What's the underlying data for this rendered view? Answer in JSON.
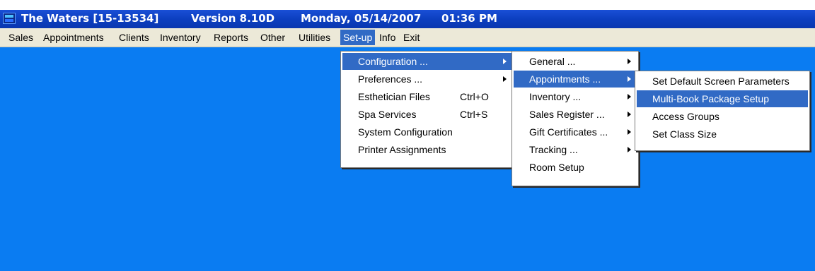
{
  "window": {
    "app_name": "The Waters [15-13534]",
    "version": "Version 8.10D",
    "date": "Monday, 05/14/2007",
    "time": "01:36 PM"
  },
  "menubar": {
    "items": [
      "Sales",
      "Appointments",
      "Clients",
      "Inventory",
      "Reports",
      "Other",
      "Utilities",
      "Set-up",
      "Info",
      "Exit"
    ],
    "active": "Set-up"
  },
  "setup_menu": {
    "items": [
      {
        "label": "Configuration ...",
        "shortcut": "",
        "submenu": true,
        "highlighted": true
      },
      {
        "label": "Preferences ...",
        "shortcut": "",
        "submenu": true,
        "highlighted": false
      },
      {
        "label": "Esthetician Files",
        "shortcut": "Ctrl+O",
        "submenu": false,
        "highlighted": false
      },
      {
        "label": "Spa Services",
        "shortcut": "Ctrl+S",
        "submenu": false,
        "highlighted": false
      },
      {
        "label": "System Configuration",
        "shortcut": "",
        "submenu": false,
        "highlighted": false
      },
      {
        "label": "Printer Assignments",
        "shortcut": "",
        "submenu": false,
        "highlighted": false
      }
    ]
  },
  "configuration_menu": {
    "items": [
      {
        "label": "General ...",
        "submenu": true,
        "highlighted": false
      },
      {
        "label": "Appointments ...",
        "submenu": true,
        "highlighted": true
      },
      {
        "label": "Inventory ...",
        "submenu": true,
        "highlighted": false
      },
      {
        "label": "Sales Register ...",
        "submenu": true,
        "highlighted": false
      },
      {
        "label": "Gift Certificates ...",
        "submenu": true,
        "highlighted": false
      },
      {
        "label": "Tracking ...",
        "submenu": true,
        "highlighted": false
      },
      {
        "label": "Room Setup",
        "submenu": false,
        "highlighted": false
      }
    ]
  },
  "appointments_menu": {
    "items": [
      {
        "label": "Set Default Screen Parameters",
        "highlighted": false
      },
      {
        "label": "Multi-Book Package Setup",
        "highlighted": true
      },
      {
        "label": "Access Groups",
        "highlighted": false
      },
      {
        "label": "Set Class Size",
        "highlighted": false
      }
    ]
  },
  "colors": {
    "desktop": "#0a7cf2",
    "titlebar": "#0c3fc0",
    "highlight": "#316ac5",
    "menubar": "#ece9d8"
  }
}
